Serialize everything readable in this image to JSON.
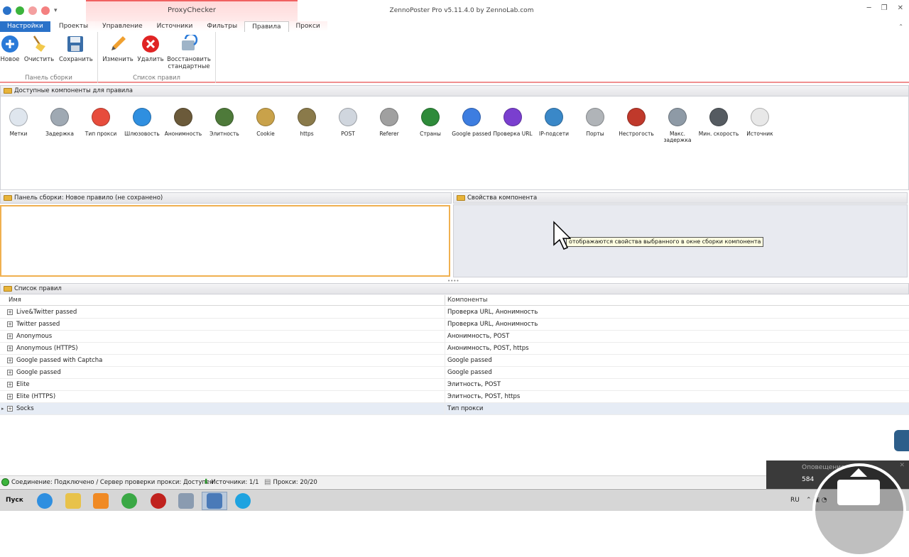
{
  "window": {
    "context_tab_header": "ProxyChecker",
    "app_title": "ZennoPoster Pro v5.11.4.0 by ZennoLab.com"
  },
  "tabs": [
    "Настройки",
    "Проекты",
    "Управление",
    "Источники",
    "Фильтры",
    "Правила",
    "Прокси"
  ],
  "active_tab": "Правила",
  "ribbon": {
    "group1": {
      "label": "Панель сборки",
      "buttons": [
        {
          "label": "Новое",
          "icon": "plus-circle-icon"
        },
        {
          "label": "Очистить",
          "icon": "broom-icon"
        },
        {
          "label": "Сохранить",
          "icon": "floppy-disk-icon"
        }
      ]
    },
    "group2": {
      "label": "Список правил",
      "buttons": [
        {
          "label": "Изменить",
          "icon": "pencil-icon"
        },
        {
          "label": "Удалить",
          "icon": "red-x-icon"
        },
        {
          "label": "Восстановить стандартные",
          "icon": "restore-icon"
        }
      ]
    }
  },
  "components_panel": {
    "title": "Доступные компоненты для правила",
    "items": [
      {
        "label": "Метки",
        "icon": "tag-icon",
        "color": "#dfe6ee"
      },
      {
        "label": "Задержка",
        "icon": "clock-icon",
        "color": "#9fa9b3"
      },
      {
        "label": "Тип прокси",
        "icon": "balls-icon",
        "color": "#e74c3c"
      },
      {
        "label": "Шлюзовость",
        "icon": "question-icon",
        "color": "#2f8fe0"
      },
      {
        "label": "Анонимность",
        "icon": "spy-icon",
        "color": "#6b5a3a"
      },
      {
        "label": "Элитность",
        "icon": "agent-icon",
        "color": "#4e7a3a"
      },
      {
        "label": "Cookie",
        "icon": "scroll-icon",
        "color": "#c9a24a"
      },
      {
        "label": "https",
        "icon": "lock-icon",
        "color": "#8a7a4a"
      },
      {
        "label": "POST",
        "icon": "form-icon",
        "color": "#d0d6de"
      },
      {
        "label": "Referer",
        "icon": "chain-icon",
        "color": "#a0a0a0"
      },
      {
        "label": "Страны",
        "icon": "flag-icon",
        "color": "#2e8b3a"
      },
      {
        "label": "Google passed",
        "icon": "google-icon",
        "color": "#3d7de0"
      },
      {
        "label": "Проверка URL",
        "icon": "globe-icon",
        "color": "#7a3fcf"
      },
      {
        "label": "IP-подсети",
        "icon": "network-icon",
        "color": "#3a88c8"
      },
      {
        "label": "Порты",
        "icon": "plug-icon",
        "color": "#b0b4b8"
      },
      {
        "label": "Нестрогость",
        "icon": "check-shield-icon",
        "color": "#c0392b"
      },
      {
        "label": "Макс. задержка",
        "icon": "stop-clock-icon",
        "color": "#8e9aa6"
      },
      {
        "label": "Мин. скорость",
        "icon": "speed-icon",
        "color": "#555b61"
      },
      {
        "label": "Источник",
        "icon": "document-icon",
        "color": "#e8e8e8"
      }
    ]
  },
  "build_panel": {
    "title": "Панель сборки: Новое правило (не сохранено)"
  },
  "props_panel": {
    "title": "Свойства компонента",
    "tooltip": "отображаются свойства выбранного в окне сборки компонента"
  },
  "rules_panel": {
    "title": "Список правил",
    "columns": [
      "Имя",
      "Компоненты"
    ],
    "rows": [
      {
        "name": "Live&Twitter passed",
        "components": "Проверка URL, Анонимность"
      },
      {
        "name": "Twitter passed",
        "components": "Проверка URL, Анонимность"
      },
      {
        "name": "Anonymous",
        "components": "Анонимность, POST"
      },
      {
        "name": "Anonymous (HTTPS)",
        "components": "Анонимность, POST, https"
      },
      {
        "name": "Google passed with Captcha",
        "components": "Google passed"
      },
      {
        "name": "Google passed",
        "components": "Google passed"
      },
      {
        "name": "Elite",
        "components": "Элитность, POST"
      },
      {
        "name": "Elite (HTTPS)",
        "components": "Элитность, POST, https"
      },
      {
        "name": "Socks",
        "components": "Тип прокси"
      }
    ]
  },
  "status": {
    "connection": "Соединение: Подключено / Сервер проверки прокси: Доступен",
    "sources": "Источники: 1/1",
    "proxies": "Прокси: 20/20"
  },
  "notification": {
    "title": "Оповещение",
    "value": "584"
  },
  "taskbar": {
    "start": "Пуск",
    "lang": "RU"
  }
}
